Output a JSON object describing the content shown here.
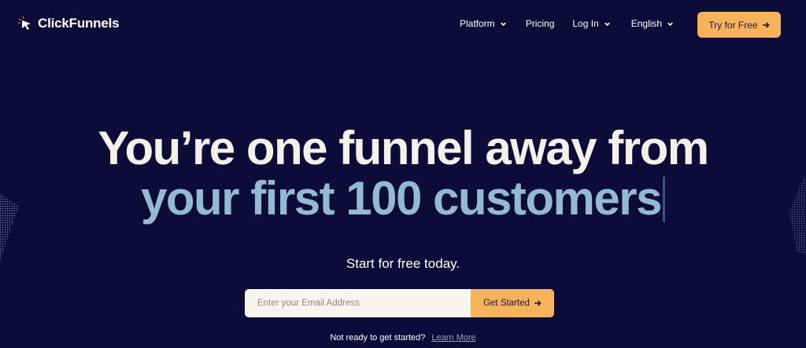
{
  "brand": {
    "name": "ClickFunnels",
    "accent_color": "#f7b25c",
    "background_color": "#0d0b37",
    "headline_color": "#f4f0ea",
    "highlight_color": "#92b9d6"
  },
  "nav": {
    "items": [
      {
        "label": "Platform",
        "icon": "chevron-down-icon"
      },
      {
        "label": "Pricing"
      },
      {
        "label": "Log In",
        "icon": "chevron-down-icon"
      },
      {
        "label": "English",
        "icon": "chevron-down-icon"
      }
    ],
    "cta_label": "Try for Free",
    "cta_icon": "arrow-right-icon"
  },
  "hero": {
    "headline_line1": "You’re one funnel away from",
    "headline_line2": "your first 100 customers",
    "subheadline": "Start for free today.",
    "email_placeholder": "Enter your Email Address",
    "submit_label": "Get Started",
    "submit_icon": "arrow-right-icon",
    "footer_text": "Not ready to get started?",
    "footer_link": "Learn More"
  }
}
